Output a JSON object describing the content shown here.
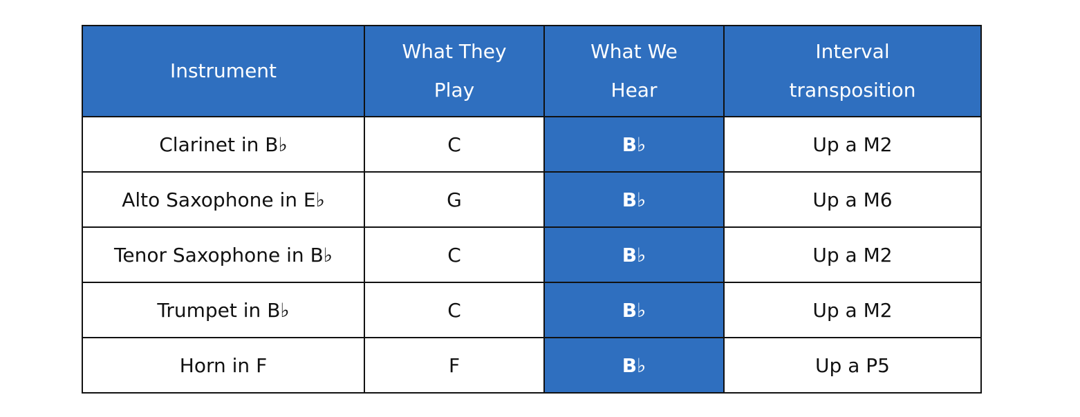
{
  "table": {
    "headers": [
      {
        "lines": [
          "Instrument"
        ]
      },
      {
        "lines": [
          "What They",
          "Play"
        ]
      },
      {
        "lines": [
          "What We",
          "Hear"
        ]
      },
      {
        "lines": [
          "Interval",
          "transposition"
        ]
      }
    ],
    "rows": [
      {
        "instrument": "Clarinet in B♭",
        "play": "C",
        "hear": "B♭",
        "interval": "Up a M2"
      },
      {
        "instrument": "Alto Saxophone in E♭",
        "play": "G",
        "hear": "B♭",
        "interval": "Up a M6"
      },
      {
        "instrument": "Tenor Saxophone in B♭",
        "play": "C",
        "hear": "B♭",
        "interval": "Up a M2"
      },
      {
        "instrument": "Trumpet in B♭",
        "play": "C",
        "hear": "B♭",
        "interval": "Up a M2"
      },
      {
        "instrument": "Horn in F",
        "play": "F",
        "hear": "B♭",
        "interval": "Up a P5"
      }
    ]
  },
  "colors": {
    "header_bg": "#2f6fbf",
    "header_text": "#ffffff",
    "border": "#111111"
  }
}
